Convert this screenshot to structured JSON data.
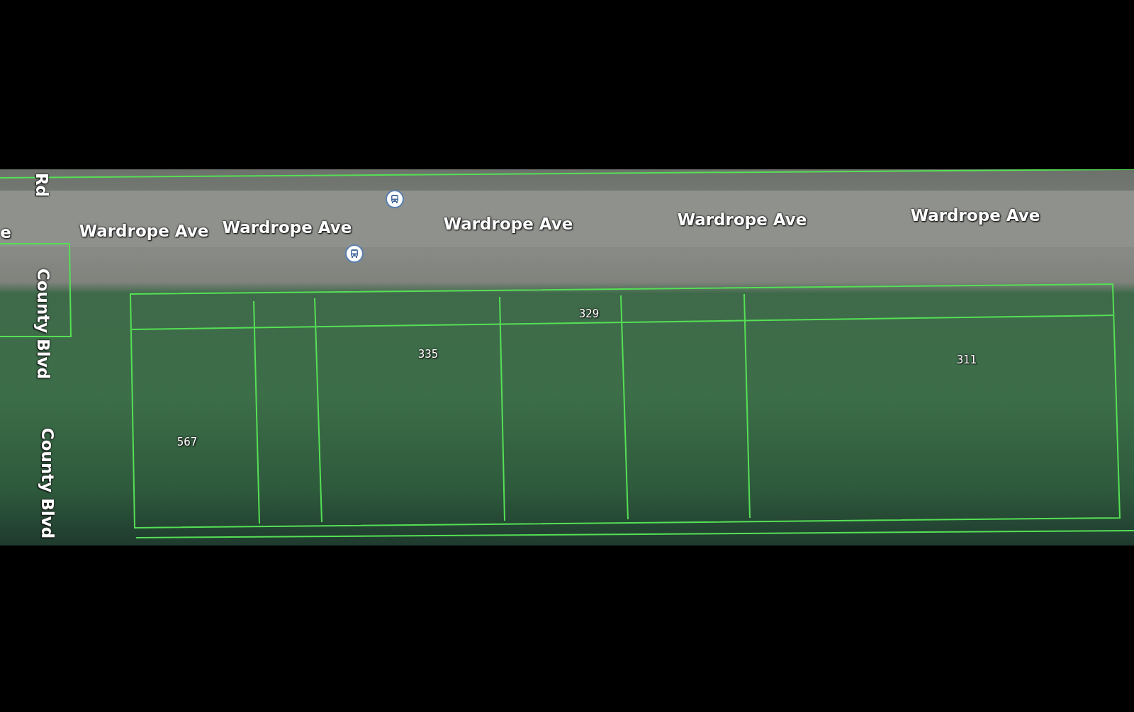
{
  "map": {
    "street_labels": [
      {
        "text": "Rd",
        "kind": "vertical"
      },
      {
        "text": "e",
        "kind": "horizontal"
      },
      {
        "text": "Wardrope Ave",
        "kind": "horizontal"
      },
      {
        "text": "Wardrope Ave",
        "kind": "horizontal"
      },
      {
        "text": "Wardrope Ave",
        "kind": "horizontal"
      },
      {
        "text": "Wardrope Ave",
        "kind": "horizontal"
      },
      {
        "text": "Wardrope Ave",
        "kind": "horizontal"
      },
      {
        "text": "County Blvd",
        "kind": "vertical"
      },
      {
        "text": "County Blvd",
        "kind": "vertical"
      }
    ],
    "lot_numbers": [
      "329",
      "335",
      "311",
      "567"
    ]
  }
}
